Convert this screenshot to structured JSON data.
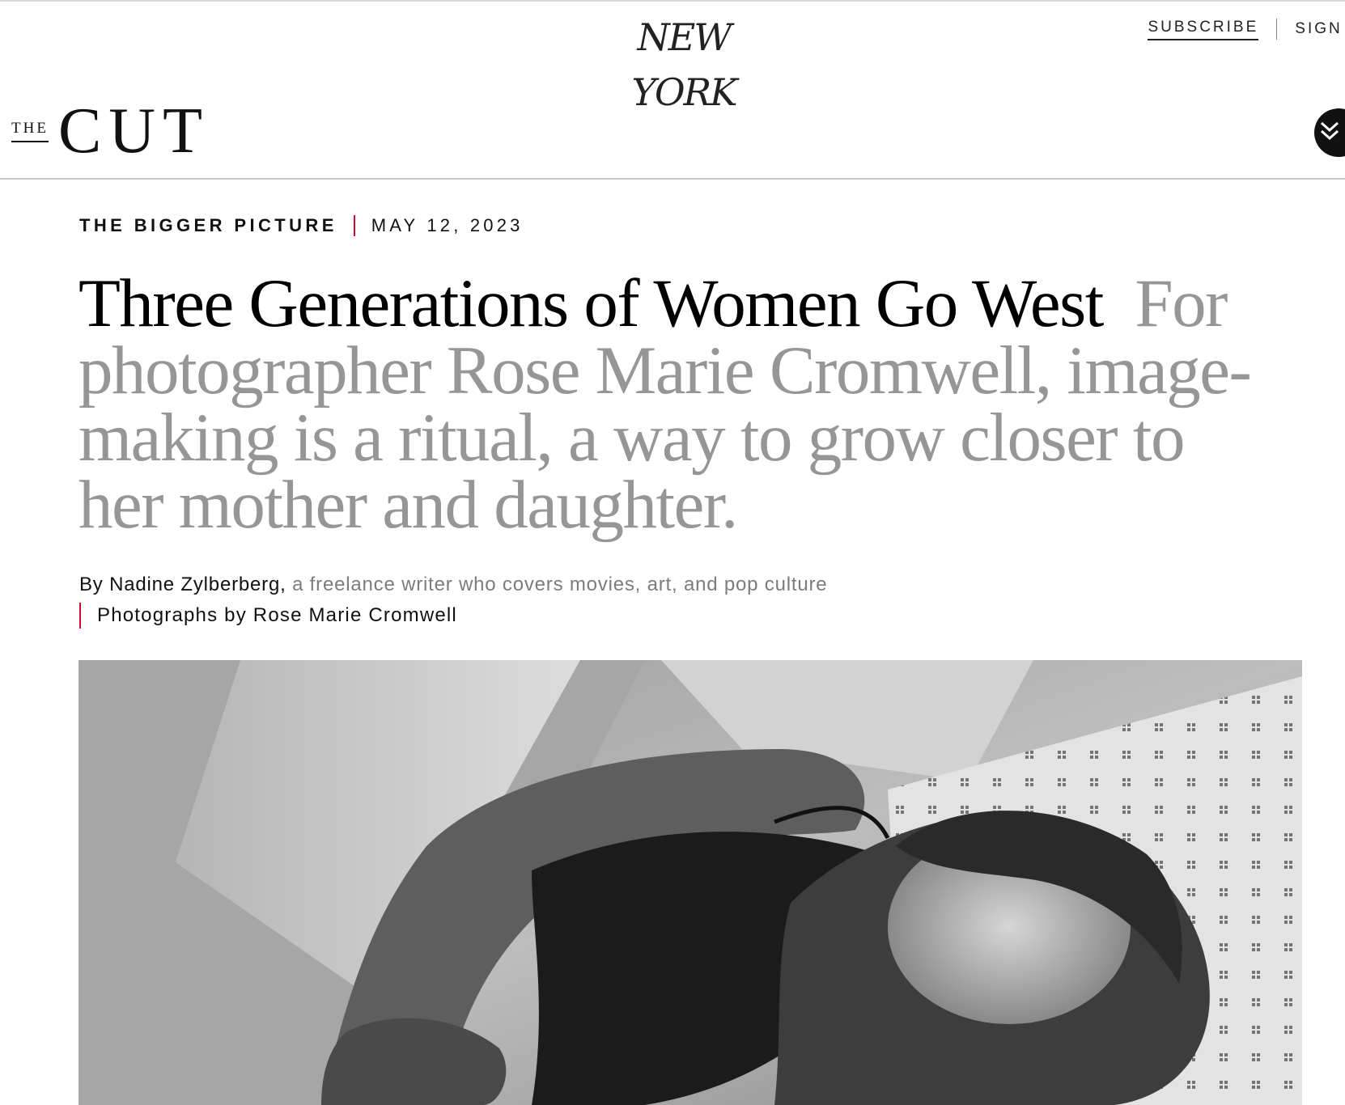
{
  "masthead": {
    "logo_text": "NEW YORK",
    "subscribe_label": "SUBSCRIBE",
    "sign_in_label": "SIGN IN"
  },
  "brand": {
    "the": "THE",
    "cut": "CUT",
    "menu_icon": "double-chevron-down-icon"
  },
  "article": {
    "rubric": "THE BIGGER PICTURE",
    "date": "MAY 12, 2023",
    "headline": "Three Generations of Women Go West",
    "dek": "For photographer Rose Marie Cromwell, image-making is a ritual, a way to grow closer to her mother and daughter.",
    "byline_prefix": "By Nadine Zylberberg,",
    "byline_desc": "a freelance writer who covers movies, art, and pop culture",
    "photo_credit": "Photographs by Rose Marie Cromwell"
  },
  "colors": {
    "accent_red": "#c8102e",
    "dek_gray": "#969696",
    "text": "#000000"
  }
}
